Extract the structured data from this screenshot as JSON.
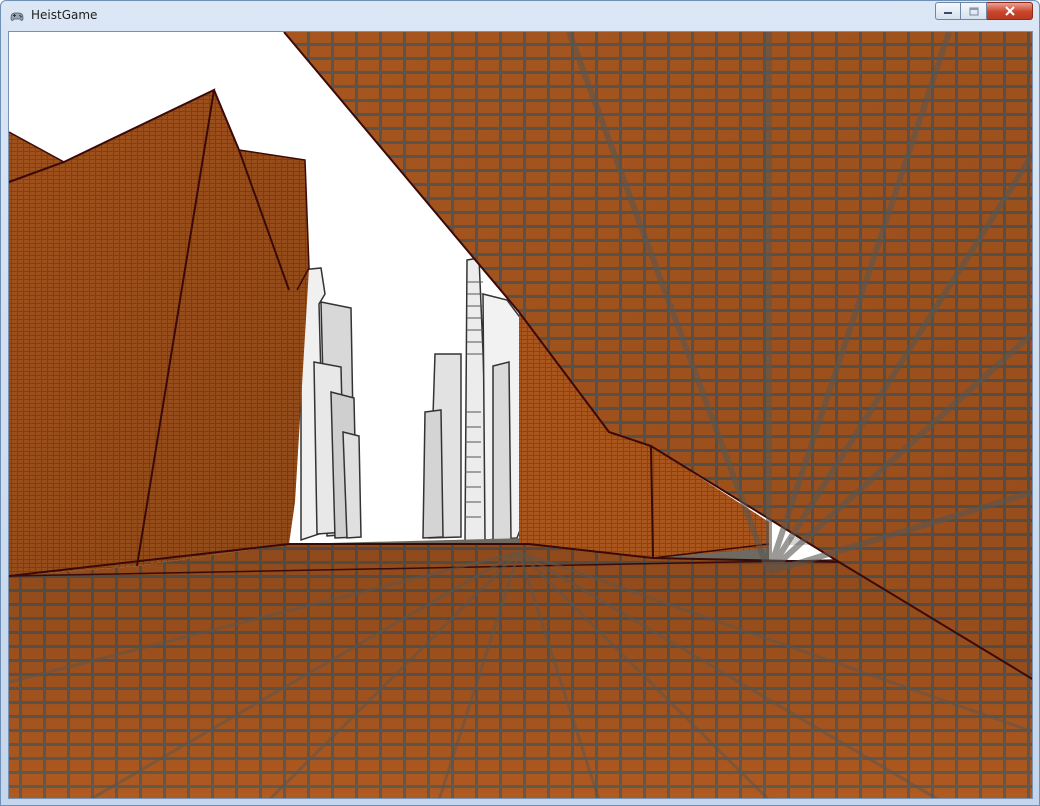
{
  "window": {
    "title": "HeistGame",
    "icon": "gamepad-icon",
    "controls": {
      "minimize_icon": "minimize-icon",
      "maximize_icon": "maximize-icon",
      "close_icon": "close-icon"
    }
  },
  "scene": {
    "sky_color": "#ffffff",
    "brick_color": "#a8561e",
    "mortar_color": "#5e5a52",
    "edge_color": "#3a0a08",
    "distant_building_color": "#e4e4e4"
  }
}
